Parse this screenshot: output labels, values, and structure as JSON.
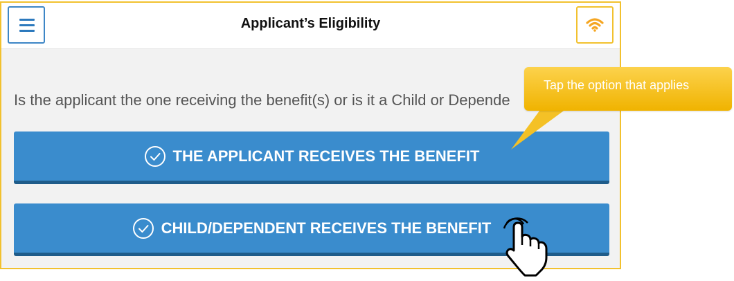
{
  "header": {
    "title": "Applicant’s Eligibility",
    "menu_icon": "hamburger-menu-icon",
    "status_icon": "wifi-icon"
  },
  "question": "Is the applicant the one receiving the benefit(s) or is it a Child or Depende",
  "options": [
    {
      "label": "THE APPLICANT RECEIVES THE BENEFIT",
      "icon": "check-circle-icon"
    },
    {
      "label": "CHILD/DEPENDENT RECEIVES THE BENEFIT",
      "icon": "check-circle-icon"
    }
  ],
  "callout": {
    "text": "Tap the option that applies"
  },
  "colors": {
    "accent_blue": "#3a8ccd",
    "frame_yellow": "#f2c12e",
    "wifi_orange": "#f5a623"
  }
}
